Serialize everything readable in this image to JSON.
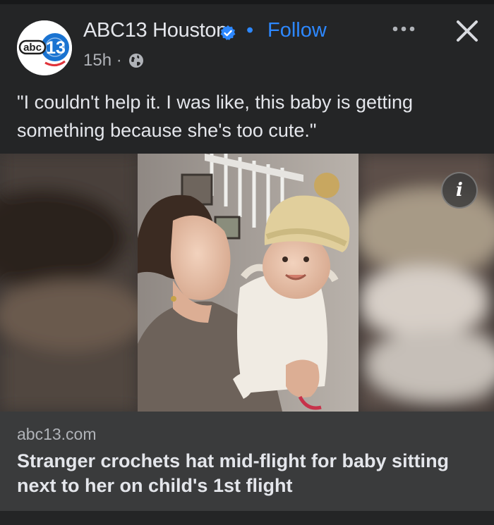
{
  "post": {
    "page_name": "ABC13 Houston",
    "separator": "•",
    "follow_label": "Follow",
    "timestamp": "15h ·",
    "caption": "\"I couldn't help it. I was like, this baby is getting something because she's too cute.\"",
    "avatar_logo": {
      "abc": "abc",
      "number": "13"
    },
    "icons": {
      "verified": "verified-badge-icon",
      "audience": "globe-icon",
      "more": "more-options-icon",
      "close": "close-icon",
      "info": "info-icon"
    },
    "info_label": "i"
  },
  "link_preview": {
    "domain": "abc13.com",
    "headline": "Stranger crochets hat mid-flight for baby sitting next to her on child's 1st flight"
  },
  "colors": {
    "background": "#242526",
    "link_box": "#3a3b3c",
    "accent": "#2d88ff",
    "text_primary": "#e4e6eb",
    "text_secondary": "#b0b3b8",
    "logo_blue": "#1a73d1"
  }
}
